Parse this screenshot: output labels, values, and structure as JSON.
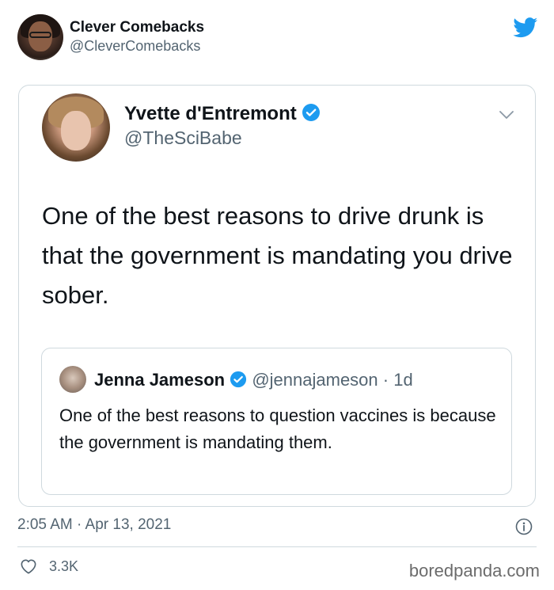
{
  "header": {
    "name": "Clever Comebacks",
    "handle": "@CleverComebacks"
  },
  "tweet": {
    "author_name": "Yvette d'Entremont",
    "author_handle": "@TheSciBabe",
    "text": "One of the best reasons to drive drunk is that the government is mandating you drive sober."
  },
  "quoted_tweet": {
    "author_name": "Jenna Jameson",
    "author_handle": "@jennajameson",
    "age": "· 1d",
    "text": "One of the best reasons to question vaccines is because the government is mandating them."
  },
  "footer": {
    "timestamp": "2:05 AM · Apr 13, 2021",
    "likes": "3.3K",
    "watermark": "boredpanda.com"
  },
  "colors": {
    "twitter_blue": "#1d9bf0",
    "secondary_text": "#536471",
    "border": "#cfd9de"
  },
  "icons": [
    "twitter-bird-icon",
    "verified-badge-icon",
    "chevron-down-icon",
    "info-icon",
    "heart-icon"
  ]
}
